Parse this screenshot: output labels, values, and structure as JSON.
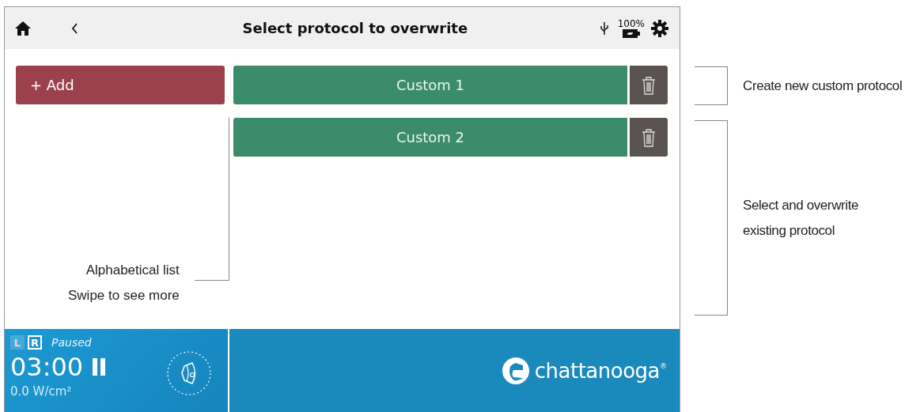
{
  "header": {
    "title": "Select protocol to overwrite",
    "battery": "100%"
  },
  "add_button": {
    "label": "+ Add"
  },
  "protocols": [
    {
      "label": "Custom 1"
    },
    {
      "label": "Custom 2"
    }
  ],
  "list_note": [
    "Alphabetical list",
    "Swipe to see more"
  ],
  "footer": {
    "sides": [
      {
        "label": "L",
        "selected": false
      },
      {
        "label": "R",
        "selected": true
      }
    ],
    "status": "Paused",
    "timer": "03:00",
    "intensity": "0.0 W/cm²",
    "brand": "chattanooga",
    "brand_mark": "®"
  },
  "annotations": [
    {
      "lines": [
        "Create new custom protocol"
      ]
    },
    {
      "lines": [
        "Select and overwrite",
        "existing protocol"
      ]
    }
  ]
}
